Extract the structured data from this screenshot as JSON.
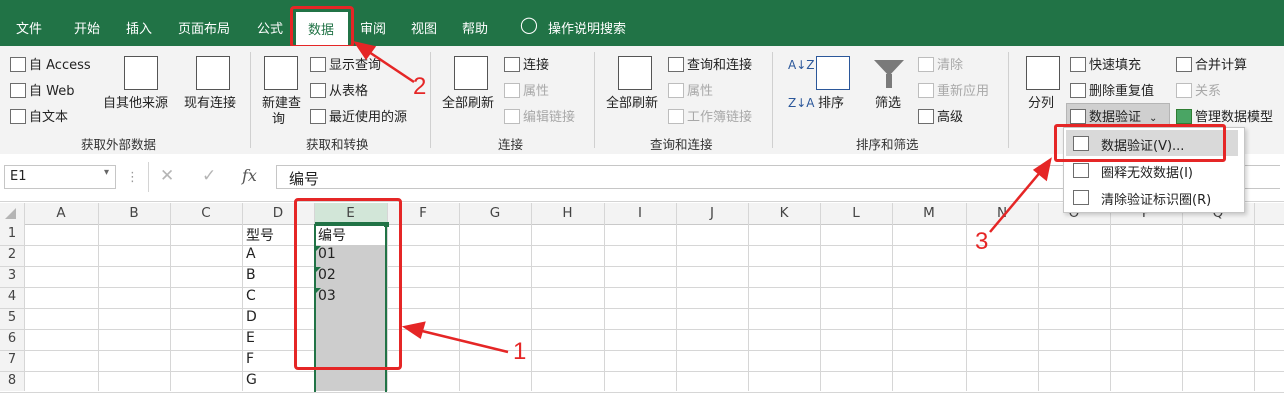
{
  "tabs": [
    "文件",
    "开始",
    "插入",
    "页面布局",
    "公式",
    "数据",
    "审阅",
    "视图",
    "帮助"
  ],
  "active_tab": "数据",
  "tell_me": "操作说明搜索",
  "ribbon": {
    "get_external": {
      "access": "自 Access",
      "web": "自 Web",
      "text": "自文本",
      "other_sources": "自其他来源",
      "existing": "现有连接",
      "label": "获取外部数据"
    },
    "get_transform": {
      "new_query": "新建查",
      "new_query2": "询",
      "show_query": "显示查询",
      "from_table": "从表格",
      "recent_sources": "最近使用的源",
      "label": "获取和转换"
    },
    "connections": {
      "refresh_all": "全部刷新",
      "connections": "连接",
      "properties": "属性",
      "edit_links": "编辑链接",
      "label": "连接"
    },
    "query_connections": {
      "refresh_all": "全部刷新",
      "query_conn": "查询和连接",
      "properties": "属性",
      "workbook_links": "工作簿链接",
      "label": "查询和连接"
    },
    "sort_filter": {
      "sort": "排序",
      "filter": "筛选",
      "clear": "清除",
      "reapply": "重新应用",
      "advanced": "高级",
      "label": "排序和筛选"
    },
    "data_tools": {
      "text_to_columns": "分列",
      "flash_fill": "快速填充",
      "remove_dupes": "删除重复值",
      "data_validation": "数据验证",
      "consolidate": "合并计算",
      "relationships": "关系",
      "manage_model": "管理数据模型"
    }
  },
  "dropdown": {
    "items": [
      "数据验证(V)...",
      "圈释无效数据(I)",
      "清除验证标识圈(R)"
    ]
  },
  "namebox": "E1",
  "formula": "编号",
  "fx": "fx",
  "columns": [
    "A",
    "B",
    "C",
    "D",
    "E",
    "F",
    "G",
    "H",
    "I",
    "J",
    "K",
    "L",
    "M",
    "N",
    "O",
    "P",
    "Q"
  ],
  "rows": [
    "1",
    "2",
    "3",
    "4",
    "5",
    "6",
    "7",
    "8"
  ],
  "col_d": [
    "型号",
    "A",
    "B",
    "C",
    "D",
    "E",
    "F",
    "G"
  ],
  "col_e": [
    "编号",
    "01",
    "02",
    "03"
  ],
  "callouts": [
    "1",
    "2",
    "3"
  ],
  "colors": {
    "excel_green": "#217346",
    "annotation_red": "#e52626"
  }
}
